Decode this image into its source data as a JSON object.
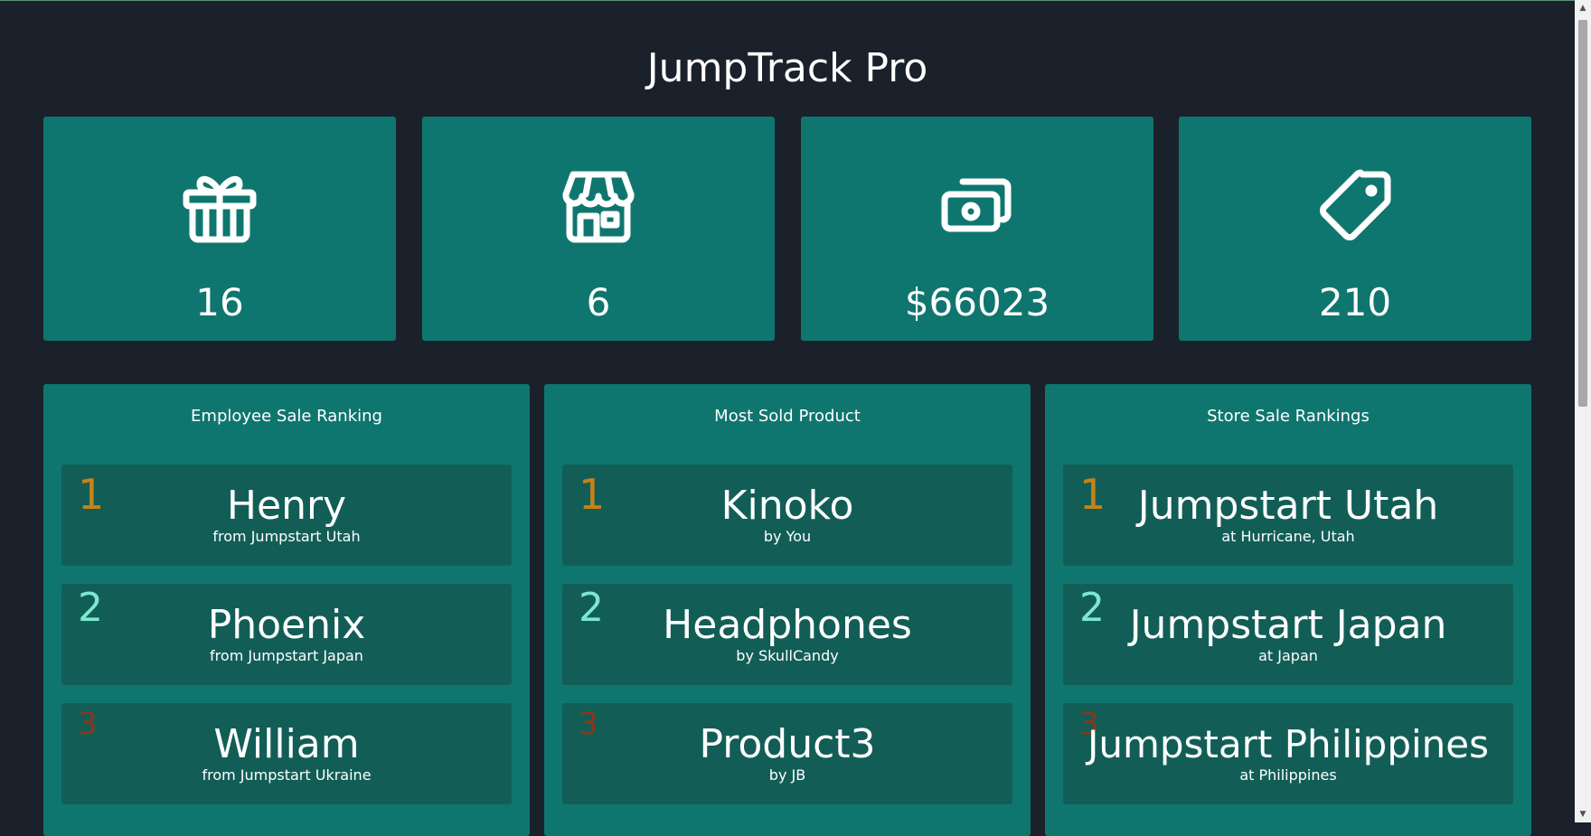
{
  "app": {
    "title": "JumpTrack Pro"
  },
  "stats": [
    {
      "icon": "gift-icon",
      "value": "16"
    },
    {
      "icon": "store-icon",
      "value": "6"
    },
    {
      "icon": "cash-icon",
      "value": "$66023"
    },
    {
      "icon": "tag-icon",
      "value": "210"
    }
  ],
  "panels": {
    "employees": {
      "title": "Employee Sale Ranking",
      "items": [
        {
          "rank": "1",
          "name": "Henry",
          "sub": "from Jumpstart Utah"
        },
        {
          "rank": "2",
          "name": "Phoenix",
          "sub": "from Jumpstart Japan"
        },
        {
          "rank": "3",
          "name": "William",
          "sub": "from Jumpstart Ukraine"
        }
      ]
    },
    "products": {
      "title": "Most Sold Product",
      "items": [
        {
          "rank": "1",
          "name": "Kinoko",
          "sub": "by You"
        },
        {
          "rank": "2",
          "name": "Headphones",
          "sub": "by SkullCandy"
        },
        {
          "rank": "3",
          "name": "Product3",
          "sub": "by JB"
        }
      ]
    },
    "stores": {
      "title": "Store Sale Rankings",
      "items": [
        {
          "rank": "1",
          "name": "Jumpstart Utah",
          "sub": "at Hurricane, Utah"
        },
        {
          "rank": "2",
          "name": "Jumpstart Japan",
          "sub": "at Japan"
        },
        {
          "rank": "3",
          "name": "Jumpstart Philippines",
          "sub": "at Philippines"
        }
      ]
    }
  },
  "colors": {
    "background": "#1b212a",
    "card": "#0f766f",
    "item": "#125e57",
    "rank_first": "#c78314",
    "rank_second": "#7de7cf",
    "rank_third": "#8e3518"
  }
}
